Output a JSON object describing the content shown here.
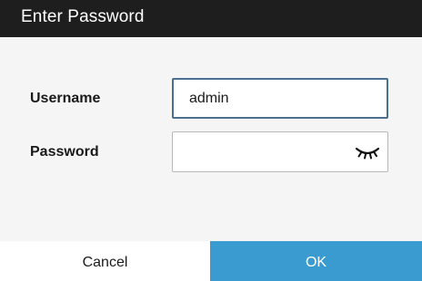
{
  "dialog": {
    "title": "Enter Password"
  },
  "form": {
    "username_label": "Username",
    "username_value": "admin",
    "password_label": "Password",
    "password_value": ""
  },
  "icons": {
    "password_toggle": "eye-closed-icon"
  },
  "buttons": {
    "cancel_label": "Cancel",
    "ok_label": "OK"
  },
  "colors": {
    "titlebar": "#1e1e1e",
    "ok_button": "#3a9bd0",
    "focused_border": "#4a6f91"
  }
}
